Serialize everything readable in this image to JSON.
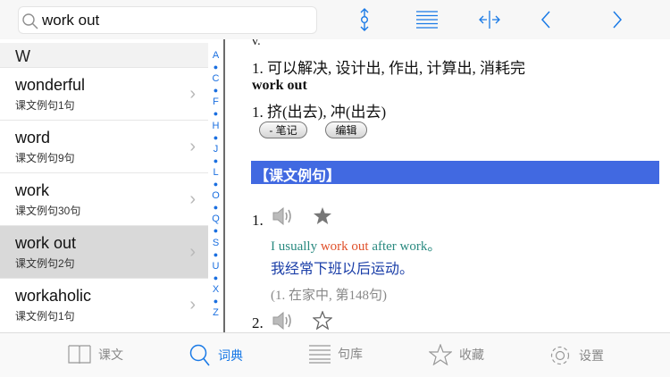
{
  "search": {
    "value": "work out"
  },
  "list": {
    "header": "W",
    "items": [
      {
        "word": "wonderful",
        "sub": "课文例句1句"
      },
      {
        "word": "word",
        "sub": "课文例句9句"
      },
      {
        "word": "work",
        "sub": "课文例句30句"
      },
      {
        "word": "work out",
        "sub": "课文例句2句",
        "selected": true
      },
      {
        "word": "workaholic",
        "sub": "课文例句1句"
      }
    ]
  },
  "index": [
    "A",
    "●",
    "C",
    "●",
    "F",
    "●",
    "H",
    "●",
    "J",
    "●",
    "L",
    "●",
    "O",
    "●",
    "Q",
    "●",
    "S",
    "●",
    "U",
    "●",
    "X",
    "●",
    "Z"
  ],
  "entry": {
    "pos": "v.",
    "def1": "1.  可以解决, 设计出, 作出, 计算出, 消耗完",
    "phrase": "work out",
    "def2": "1.  挤(出去), 冲(出去)",
    "note_btn": "- 笔记",
    "edit_btn": "编辑"
  },
  "section": "【课文例句】",
  "examples": [
    {
      "num": "1.",
      "en_a": "I usually ",
      "en_hl": "work out",
      "en_b": " after work。",
      "zh": "我经常下班以后运动。",
      "src": "(1. 在家中, 第148句)"
    },
    {
      "num": "2."
    }
  ],
  "tabs": [
    {
      "label": "课文",
      "icon": "book-icon"
    },
    {
      "label": "词典",
      "icon": "search-icon"
    },
    {
      "label": "句库",
      "icon": "list-icon"
    },
    {
      "label": "收藏",
      "icon": "star-icon"
    },
    {
      "label": "设置",
      "icon": "gear-icon"
    }
  ],
  "colors": {
    "accent": "#1a7ae6",
    "band": "#4169e1",
    "highlight": "#e0502a",
    "en": "#2a8a80",
    "zh": "#1a3ea8"
  }
}
